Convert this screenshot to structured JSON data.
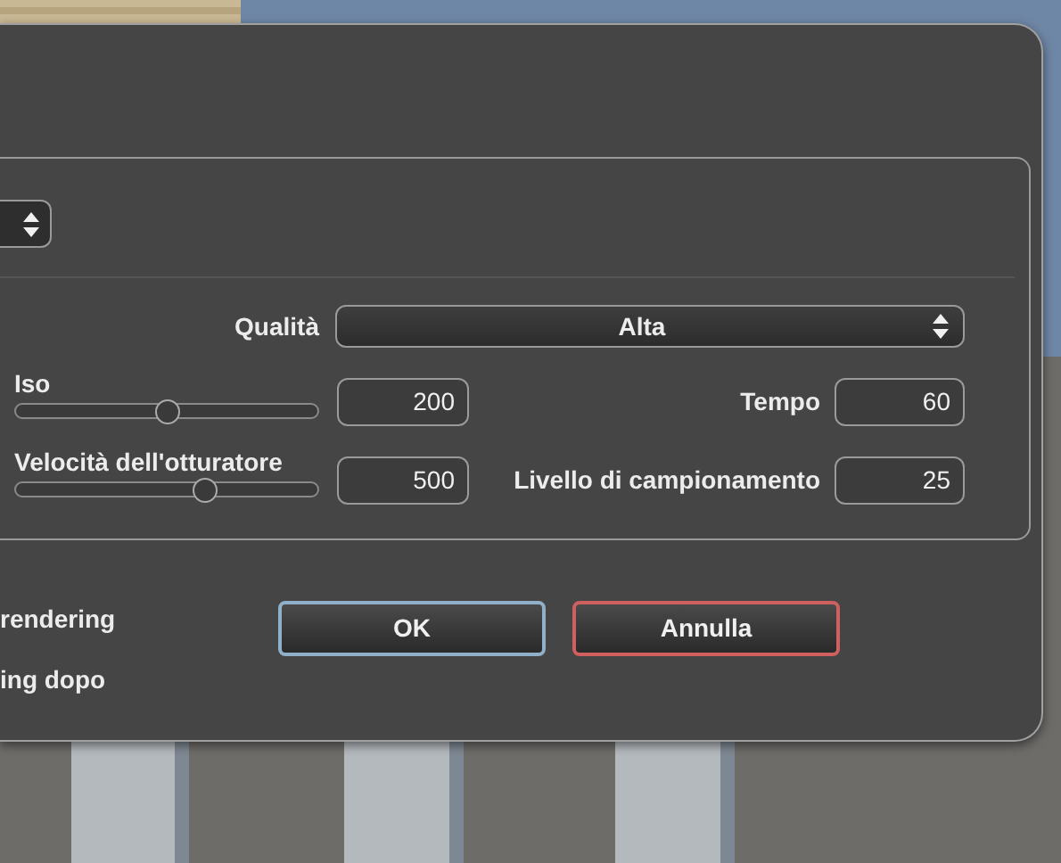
{
  "quality": {
    "label": "Qualità",
    "value": "Alta"
  },
  "params": [
    {
      "label": "Iso",
      "level": 0.5,
      "value": "200",
      "side_label": "Tempo",
      "side_value": "60"
    },
    {
      "label": "Velocità dell'otturatore",
      "level": 0.63,
      "value": "500",
      "side_label": "Livello di campionamento",
      "side_value": "25"
    }
  ],
  "options": [
    "rendering",
    "ing dopo"
  ],
  "buttons": [
    {
      "label": "OK",
      "kind": "confirm"
    },
    {
      "label": "Annulla",
      "kind": "cancel"
    }
  ]
}
